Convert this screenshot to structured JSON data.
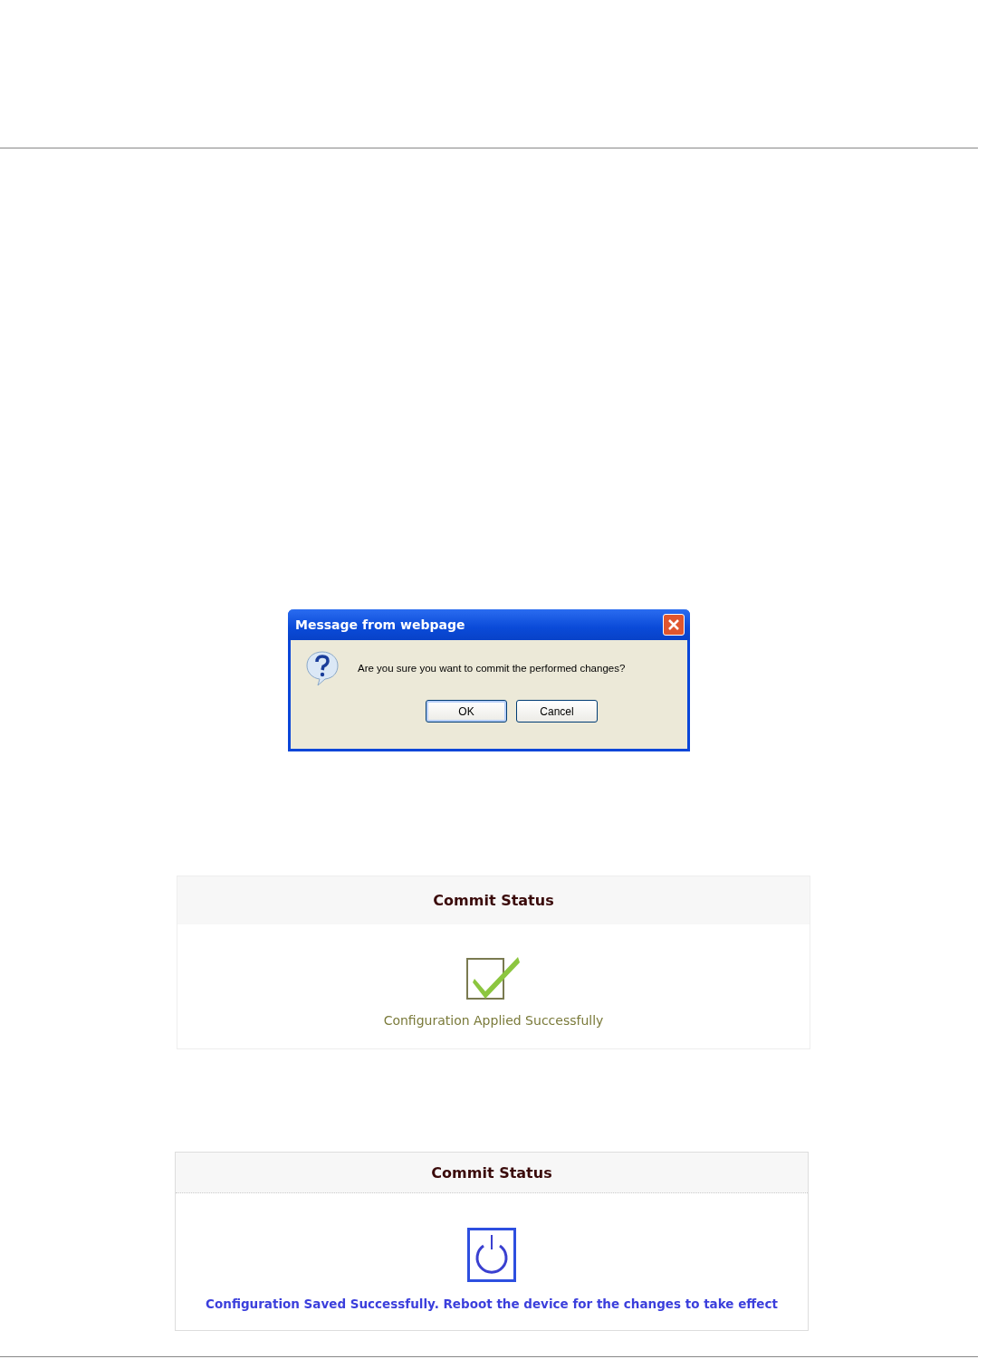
{
  "dialog": {
    "title": "Message from webpage",
    "message": "Are you sure you want to commit the performed changes?",
    "buttons": [
      {
        "label": "OK",
        "selected": true
      },
      {
        "label": "Cancel",
        "selected": false
      }
    ]
  },
  "panels": [
    {
      "kind": "applied",
      "title": "Commit Status",
      "message": "Configuration Applied Successfully"
    },
    {
      "kind": "saved",
      "title": "Commit Status",
      "message": "Configuration Saved Successfully. Reboot the device for the changes to take effect"
    }
  ]
}
